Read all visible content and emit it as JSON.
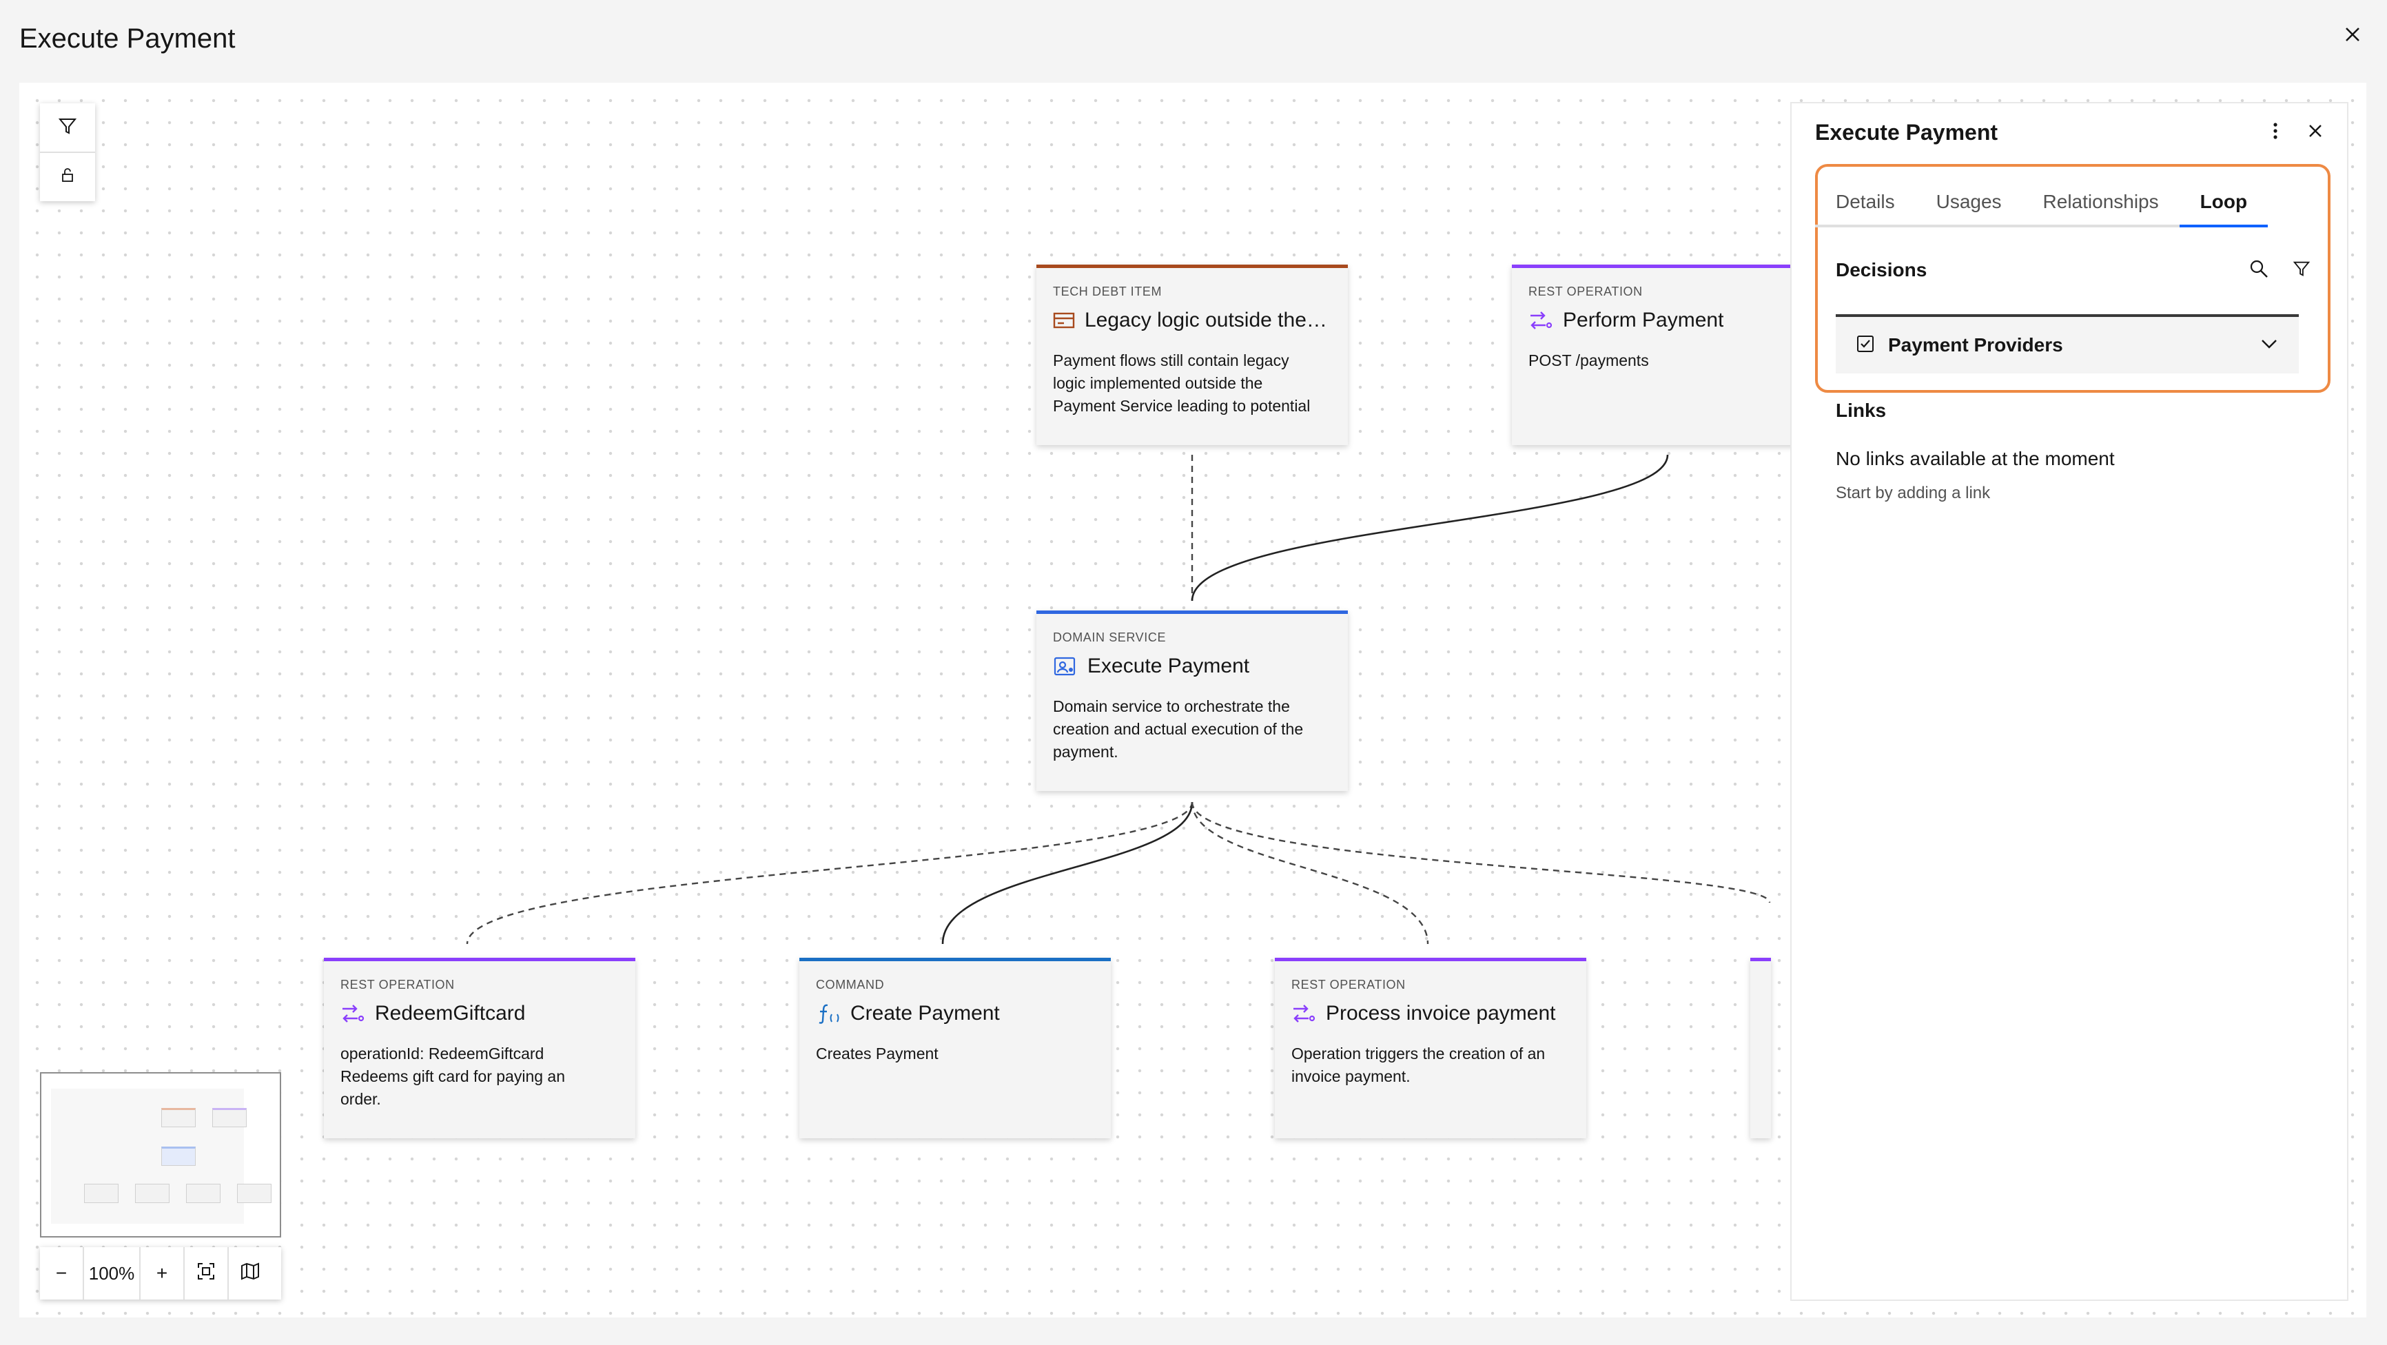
{
  "window": {
    "title": "Execute Payment"
  },
  "canvas": {
    "tools": {
      "filter_icon": "filter-icon",
      "lock_icon": "unlock-icon"
    },
    "zoom": {
      "level": "100%",
      "minus": "−",
      "plus": "+"
    }
  },
  "nodes": [
    {
      "id": "tech-debt",
      "kind": "TECH DEBT ITEM",
      "title": "Legacy logic outside the Payment Service",
      "description": "Payment flows still contain legacy\nlogic implemented outside the\nPayment Service leading to potential",
      "accent": "#a84a1e",
      "icon": "tech-debt-icon"
    },
    {
      "id": "perform-payment",
      "kind": "REST OPERATION",
      "title": "Perform Payment",
      "description": "POST /payments",
      "accent": "#8a3ffc",
      "icon": "rest-operation-icon"
    },
    {
      "id": "execute-payment",
      "kind": "DOMAIN SERVICE",
      "title": "Execute Payment",
      "description": "Domain service to orchestrate the\ncreation and actual execution of the\npayment.",
      "accent": "#2f67e0",
      "icon": "domain-service-icon"
    },
    {
      "id": "redeem-giftcard",
      "kind": "REST OPERATION",
      "title": "RedeemGiftcard",
      "description": "operationId: RedeemGiftcard\nRedeems gift card for paying an\norder.",
      "accent": "#8a3ffc",
      "icon": "rest-operation-icon"
    },
    {
      "id": "create-payment",
      "kind": "COMMAND",
      "title": "Create Payment",
      "description": "Creates Payment",
      "accent": "#1a6fc4",
      "icon": "command-icon"
    },
    {
      "id": "process-invoice",
      "kind": "REST OPERATION",
      "title": "Process invoice payment",
      "description": "Operation triggers the creation of an\ninvoice payment.",
      "accent": "#8a3ffc",
      "icon": "rest-operation-icon"
    }
  ],
  "panel": {
    "title": "Execute Payment",
    "tabs": [
      {
        "label": "Details",
        "active": false
      },
      {
        "label": "Usages",
        "active": false
      },
      {
        "label": "Relationships",
        "active": false
      },
      {
        "label": "Loop",
        "active": true
      }
    ],
    "decisions": {
      "heading": "Decisions",
      "items": [
        {
          "label": "Payment Providers",
          "checked": true
        }
      ]
    },
    "links": {
      "heading": "Links",
      "empty_title": "No links available at the moment",
      "empty_hint": "Start by adding a link"
    },
    "highlight_color": "#ee8a44"
  }
}
